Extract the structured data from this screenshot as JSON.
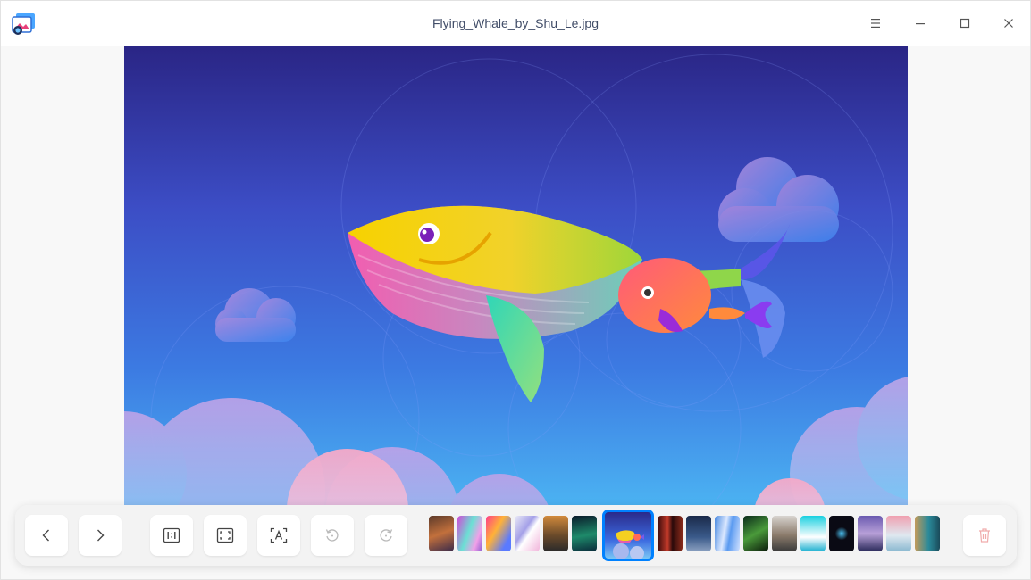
{
  "window": {
    "title": "Flying_Whale_by_Shu_Le.jpg",
    "accent_color": "#0081ff"
  },
  "titlebar": {
    "app_icon": "image-viewer-icon",
    "buttons": [
      {
        "name": "menu-icon"
      },
      {
        "name": "minimize-icon"
      },
      {
        "name": "maximize-icon"
      },
      {
        "name": "close-icon"
      }
    ]
  },
  "toolbar": {
    "buttons": [
      {
        "name": "previous-button",
        "icon": "chevron-left-icon",
        "enabled": true
      },
      {
        "name": "next-button",
        "icon": "chevron-right-icon",
        "enabled": true
      },
      {
        "name": "original-size-button",
        "icon": "one-to-one-icon",
        "enabled": true
      },
      {
        "name": "fit-window-button",
        "icon": "fit-screen-icon",
        "enabled": true
      },
      {
        "name": "ocr-button",
        "icon": "text-recognition-icon",
        "enabled": true
      },
      {
        "name": "rotate-left-button",
        "icon": "rotate-counterclockwise-icon",
        "enabled": false
      },
      {
        "name": "rotate-right-button",
        "icon": "rotate-clockwise-icon",
        "enabled": false
      },
      {
        "name": "delete-button",
        "icon": "trash-icon",
        "enabled": false
      }
    ],
    "thumbnails_count": 18,
    "current_thumbnail_index": 6
  }
}
